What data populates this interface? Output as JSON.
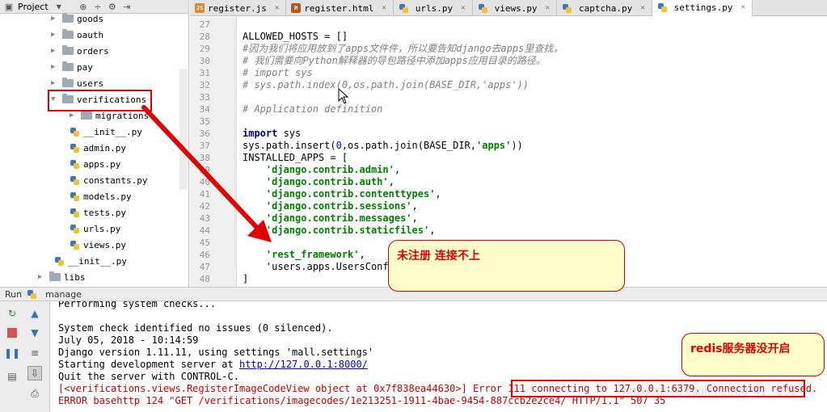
{
  "project": {
    "title": "Project",
    "tree": [
      {
        "label": "goods",
        "kind": "folder",
        "expanded": false
      },
      {
        "label": "oauth",
        "kind": "folder",
        "expanded": false
      },
      {
        "label": "orders",
        "kind": "folder",
        "expanded": false
      },
      {
        "label": "pay",
        "kind": "folder",
        "expanded": false
      },
      {
        "label": "users",
        "kind": "folder",
        "expanded": false
      },
      {
        "label": "verifications",
        "kind": "folder",
        "expanded": true
      },
      {
        "label": "migrations",
        "kind": "folder",
        "expanded": false
      },
      {
        "label": "__init__.py",
        "kind": "py"
      },
      {
        "label": "admin.py",
        "kind": "py"
      },
      {
        "label": "apps.py",
        "kind": "py"
      },
      {
        "label": "constants.py",
        "kind": "py"
      },
      {
        "label": "models.py",
        "kind": "py"
      },
      {
        "label": "tests.py",
        "kind": "py"
      },
      {
        "label": "urls.py",
        "kind": "py"
      },
      {
        "label": "views.py",
        "kind": "py"
      },
      {
        "label": "__init__.py",
        "kind": "py"
      },
      {
        "label": "libs",
        "kind": "folder",
        "expanded": false
      }
    ]
  },
  "tabs": [
    {
      "label": "register.js",
      "icon": "js-file-icon",
      "active": false
    },
    {
      "label": "register.html",
      "icon": "html-file-icon",
      "active": false
    },
    {
      "label": "urls.py",
      "icon": "python-file-icon",
      "active": false
    },
    {
      "label": "views.py",
      "icon": "python-file-icon",
      "active": false
    },
    {
      "label": "captcha.py",
      "icon": "python-file-icon",
      "active": false
    },
    {
      "label": "settings.py",
      "icon": "python-file-icon",
      "active": true
    }
  ],
  "editor": {
    "line_numbers": [
      "27",
      "28",
      "29",
      "30",
      "31",
      "32",
      "33",
      "34",
      "35",
      "36",
      "37",
      "38",
      "39",
      "40",
      "41",
      "42",
      "43",
      "44",
      "45",
      "46",
      "47",
      "48"
    ],
    "lines": [
      "",
      "ALLOWED_HOSTS = []",
      "#因为我们将应用放到了apps文件件，所以要告知django去apps里查找，",
      "# 我们需要向Python解释器的导包路径中添加apps应用目录的路径。",
      "# import sys",
      "# sys.path.index(0,os.path.join(BASE_DIR,'apps'))",
      "",
      "# Application definition",
      "",
      "import sys",
      "sys.path.insert(0,os.path.join(BASE_DIR,'apps'))",
      "INSTALLED_APPS = [",
      "    'django.contrib.admin',",
      "    'django.contrib.auth',",
      "    'django.contrib.contenttypes',",
      "    'django.contrib.sessions',",
      "    'django.contrib.messages',",
      "    'django.contrib.staticfiles',",
      "",
      "    'rest_framework',",
      "    'users.apps.UsersConfi",
      "]"
    ]
  },
  "run": {
    "tab_label": "Run",
    "config_name": "manage"
  },
  "console": {
    "lines": [
      "Performing system checks...",
      "",
      "System check identified no issues (0 silenced).",
      "July 05, 2018 - 10:14:59",
      "Django version 1.11.11, using settings 'mall.settings'",
      "Starting development server at http://127.0.0.1:8000/",
      "Quit the server with CONTROL-C.",
      "[<verifications.views.RegisterImageCodeView object at 0x7f838ea44630>] Error 111 connecting to 127.0.0.1:6379. Connection refused.",
      "ERROR basehttp 124 \"GET /verifications/imagecodes/1e213251-1911-4bae-9454-887ccb2e2ce4/ HTTP/1.1\" 507 35"
    ],
    "server_prefix": "Starting development server at ",
    "server_url": "http://127.0.0.1:8000/"
  },
  "annotations": {
    "note1": "未注册  连接不上",
    "note2": "redis服务器没开启"
  },
  "watermark": "https://blog.csdn.net/qq_41...632"
}
